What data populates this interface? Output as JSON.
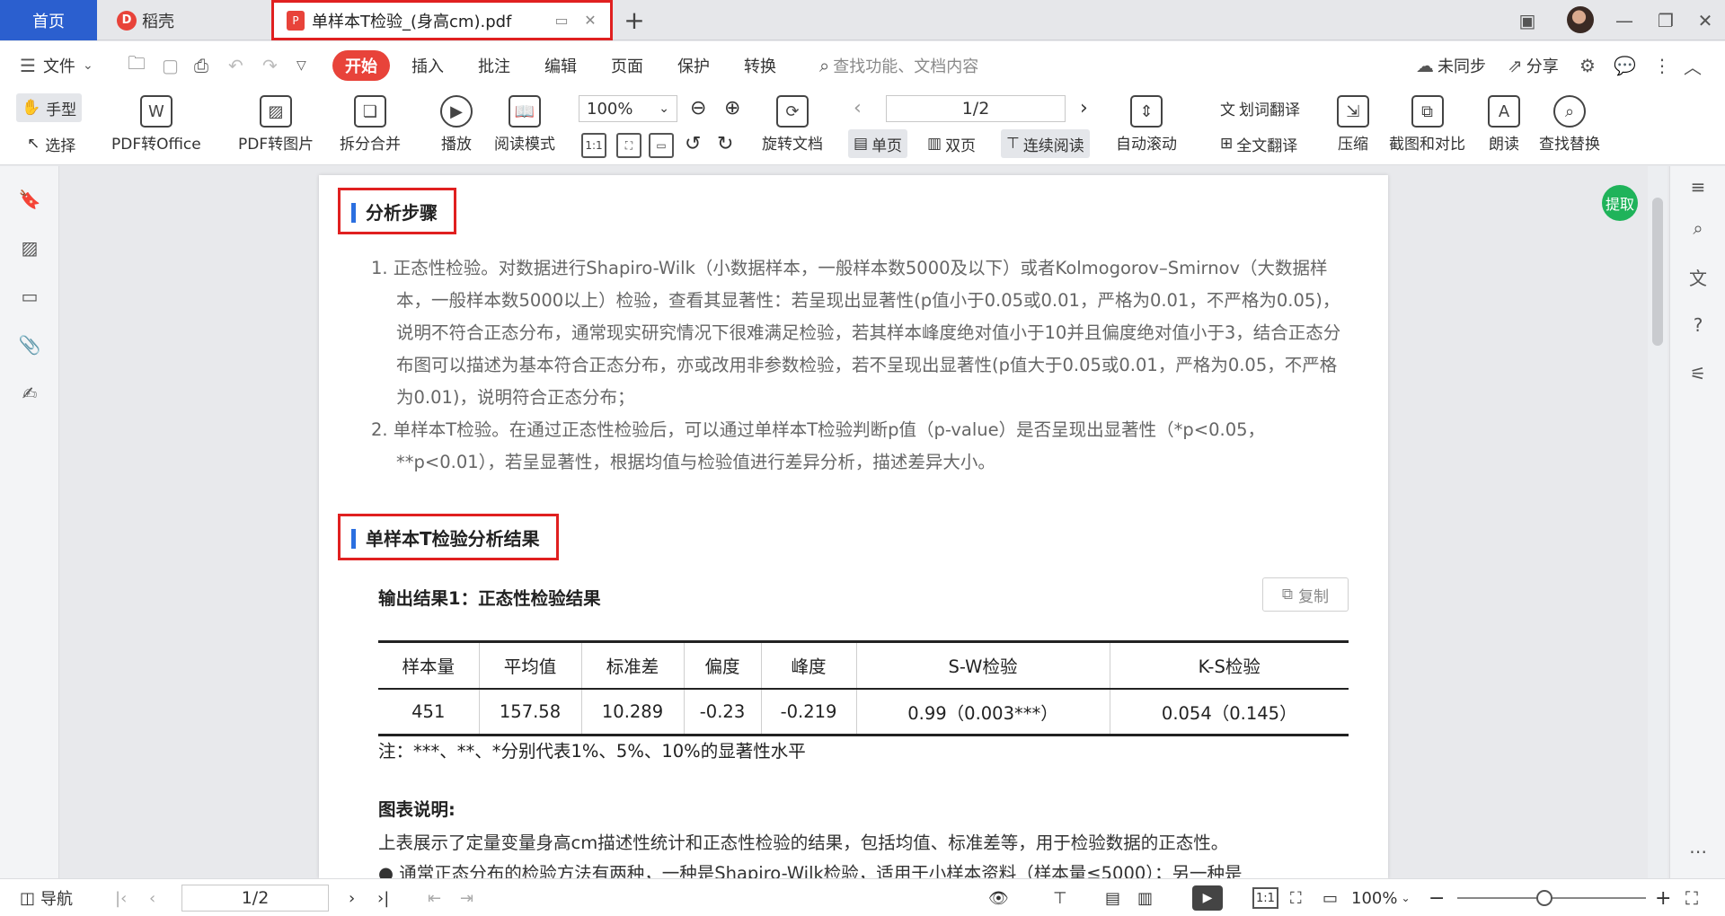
{
  "tabs": {
    "home": "首页",
    "daoke": "稻壳",
    "document": "单样本T检验_(身高cm).pdf",
    "plus": "+"
  },
  "menu": {
    "file": "文件",
    "items": [
      "开始",
      "插入",
      "批注",
      "编辑",
      "页面",
      "保护",
      "转换"
    ],
    "search_placeholder": "查找功能、文档内容",
    "sync": "未同步",
    "share": "分享"
  },
  "toolbar": {
    "hand": "手型",
    "select": "选择",
    "pdf_to_office": "PDF转Office",
    "pdf_to_image": "PDF转图片",
    "split_merge": "拆分合并",
    "play": "播放",
    "reading_mode": "阅读模式",
    "zoom": "100%",
    "rotate_doc": "旋转文档",
    "page_indicator": "1/2",
    "single_page": "单页",
    "double_page": "双页",
    "continuous": "连续阅读",
    "auto_scroll": "自动滚动",
    "word_translate": "划词翻译",
    "full_translate": "全文翻译",
    "compress": "压缩",
    "screenshot_compare": "截图和对比",
    "read_aloud": "朗读",
    "find_replace": "查找替换",
    "ratio_label": "1:1"
  },
  "float_button": "提取",
  "content": {
    "section1_title": "分析步骤",
    "step1": "1. 正态性检验。对数据进行Shapiro-Wilk（小数据样本，一般样本数5000及以下）或者Kolmogorov–Smirnov（大数据样本，一般样本数5000以上）检验，查看其显著性：若呈现出显著性(p值小于0.05或0.01，严格为0.01，不严格为0.05)，说明不符合正态分布，通常现实研究情况下很难满足检验，若其样本峰度绝对值小于10并且偏度绝对值小于3，结合正态分布图可以描述为基本符合正态分布，亦或改用非参数检验，若不呈现出显著性(p值大于0.05或0.01，严格为0.05，不严格为0.01)，说明符合正态分布；",
    "step2": "2. 单样本T检验。在通过正态性检验后，可以通过单样本T检验判断p值（p-value）是否呈现出显著性（*p<0.05，**p<0.01），若呈显著性，根据均值与检验值进行差异分析，描述差异大小。",
    "section2_title": "单样本T检验分析结果",
    "output_title": "输出结果1：正态性检验结果",
    "copy": "复制",
    "table": {
      "headers": [
        "样本量",
        "平均值",
        "标准差",
        "偏度",
        "峰度",
        "S-W检验",
        "K-S检验"
      ],
      "row": [
        "451",
        "157.58",
        "10.289",
        "-0.23",
        "-0.219",
        "0.99（0.003***）",
        "0.054（0.145）"
      ]
    },
    "note": "注：***、**、*分别代表1%、5%、10%的显著性水平",
    "chart_label": "图表说明:",
    "chart_desc": "上表展示了定量变量身高cm描述性统计和正态性检验的结果，包括均值、标准差等，用于检验数据的正态性。",
    "bullet": "● 通常正态分布的检验方法有两种，一种是Shapiro-Wilk检验，适用于小样本资料（样本量≤5000）；另一种是"
  },
  "statusbar": {
    "nav": "导航",
    "page": "1/2",
    "zoom": "100%",
    "ratio_label": "1:1"
  }
}
